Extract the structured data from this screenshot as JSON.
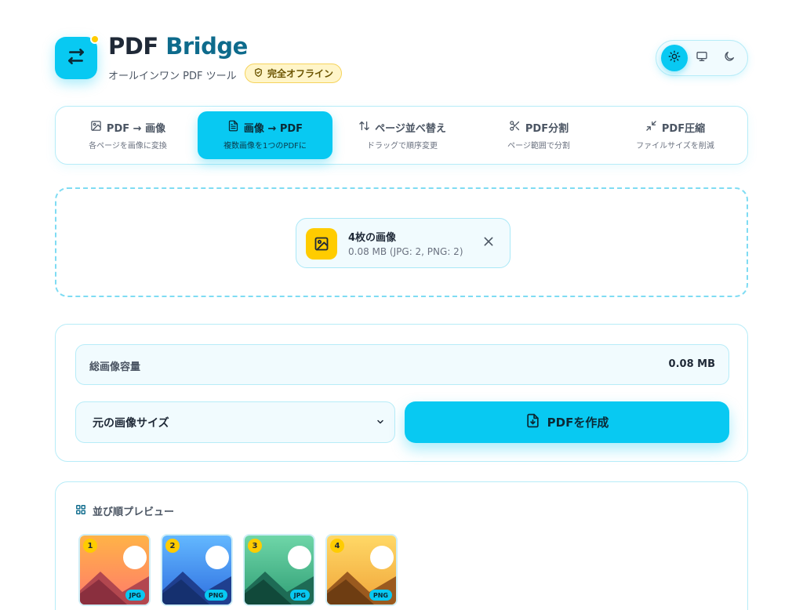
{
  "app": {
    "brand_part1": "PDF",
    "brand_part2": "Bridge",
    "subtitle": "オールインワン PDF ツール",
    "badge": "完全オフライン",
    "logo_icon": "arrows-swap-icon",
    "accent_color": "#08c9f2",
    "brand_color": "#0e6b8c",
    "badge_color": "#ffcc00"
  },
  "theme_toggle": {
    "options": [
      {
        "icon": "sun-icon",
        "selected": true
      },
      {
        "icon": "monitor-icon",
        "selected": false
      },
      {
        "icon": "moon-icon",
        "selected": false
      }
    ]
  },
  "tabs": [
    {
      "title": "PDF → 画像",
      "sub": "各ページを画像に変換",
      "icon": "image-icon",
      "active": false
    },
    {
      "title": "画像 → PDF",
      "sub": "複数画像を1つのPDFに",
      "icon": "document-icon",
      "active": true
    },
    {
      "title": "ページ並べ替え",
      "sub": "ドラッグで順序変更",
      "icon": "sort-arrows-icon",
      "active": false
    },
    {
      "title": "PDF分割",
      "sub": "ページ範囲で分割",
      "icon": "scissors-icon",
      "active": false
    },
    {
      "title": "PDF圧縮",
      "sub": "ファイルサイズを削減",
      "icon": "compress-icon",
      "active": false
    }
  ],
  "upload": {
    "file_title": "4枚の画像",
    "file_meta": "0.08 MB (JPG: 2, PNG: 2)",
    "file_icon": "image-icon"
  },
  "settings": {
    "total_label": "総画像容量",
    "total_value": "0.08 MB",
    "size_select_value": "元の画像サイズ",
    "create_button": "PDFを作成"
  },
  "preview": {
    "title": "並び順プレビュー",
    "items": [
      {
        "num": "1",
        "format": "JPG",
        "sky_top": "#ffb347",
        "sky_bottom": "#ff7a6b",
        "hill_back": "#b2474f",
        "hill_front": "#8a2f3e"
      },
      {
        "num": "2",
        "format": "PNG",
        "sky_top": "#63b8ff",
        "sky_bottom": "#2f6fe0",
        "hill_back": "#1f3f8f",
        "hill_front": "#15306f"
      },
      {
        "num": "3",
        "format": "JPG",
        "sky_top": "#6fd6a8",
        "sky_bottom": "#2f9e75",
        "hill_back": "#1e6b55",
        "hill_front": "#11493a"
      },
      {
        "num": "4",
        "format": "PNG",
        "sky_top": "#ffd866",
        "sky_bottom": "#f0a53a",
        "hill_back": "#9a5a1f",
        "hill_front": "#6e3d12"
      }
    ]
  }
}
